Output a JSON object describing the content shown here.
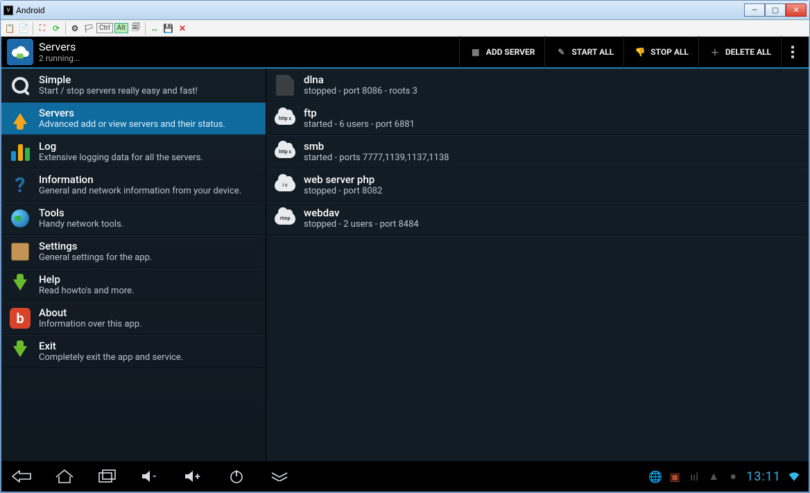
{
  "window": {
    "title": "Android"
  },
  "toolbar_modkeys": {
    "ctrl": "Ctrl",
    "alt": "Alt"
  },
  "header": {
    "title": "Servers",
    "subtitle": "2 running...",
    "actions": {
      "add": "ADD SERVER",
      "start": "START ALL",
      "stop": "STOP ALL",
      "delete": "DELETE ALL"
    }
  },
  "menu": {
    "simple": {
      "title": "Simple",
      "sub": "Start / stop servers really easy and fast!"
    },
    "servers": {
      "title": "Servers",
      "sub": "Advanced add or view servers and their status."
    },
    "log": {
      "title": "Log",
      "sub": "Extensive logging data for all the servers."
    },
    "information": {
      "title": "Information",
      "sub": "General and network information from your device."
    },
    "tools": {
      "title": "Tools",
      "sub": "Handy network tools."
    },
    "settings": {
      "title": "Settings",
      "sub": "General settings for the app."
    },
    "help": {
      "title": "Help",
      "sub": "Read howto's and more."
    },
    "about": {
      "title": "About",
      "sub": "Information over this app."
    },
    "exit": {
      "title": "Exit",
      "sub": "Completely exit the app and service."
    }
  },
  "servers": {
    "dlna": {
      "name": "dlna",
      "status": "stopped - port 8086 - roots 3",
      "badge": ""
    },
    "ftp": {
      "name": "ftp",
      "status": "started - 6 users - port 6881",
      "badge": "http s"
    },
    "smb": {
      "name": "smb",
      "status": "started - ports 7777,1139,1137,1138",
      "badge": "http s"
    },
    "php": {
      "name": "web server php",
      "status": "stopped - port 8082",
      "badge": "i c"
    },
    "webdav": {
      "name": "webdav",
      "status": "stopped - 2 users - port 8484",
      "badge": "rtmp"
    }
  },
  "status": {
    "clock": "13:11"
  }
}
